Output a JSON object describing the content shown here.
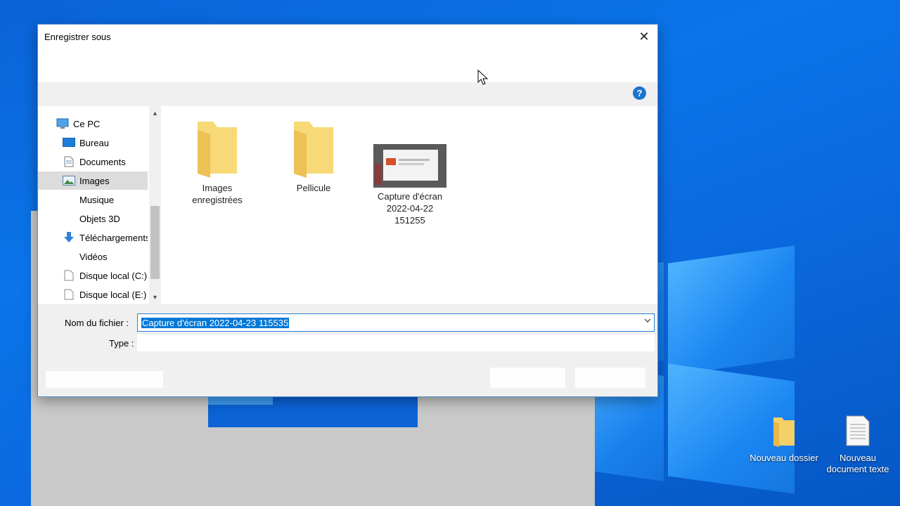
{
  "dialog": {
    "title": "Enregistrer sous",
    "help_symbol": "?",
    "close_symbol": "✕"
  },
  "nav": {
    "items": [
      {
        "label": "Ce PC",
        "icon": "pc-icon"
      },
      {
        "label": "Bureau",
        "icon": "desktop-icon"
      },
      {
        "label": "Documents",
        "icon": "documents-icon"
      },
      {
        "label": "Images",
        "icon": "pictures-icon",
        "selected": true
      },
      {
        "label": "Musique",
        "icon": "music-icon"
      },
      {
        "label": "Objets 3D",
        "icon": "objects3d-icon"
      },
      {
        "label": "Téléchargements",
        "icon": "download-icon"
      },
      {
        "label": "Vidéos",
        "icon": "videos-icon"
      },
      {
        "label": "Disque local (C:)",
        "icon": "drive-icon"
      },
      {
        "label": "Disque local (E:)",
        "icon": "drive-icon"
      }
    ]
  },
  "files": [
    {
      "line1": "Images",
      "line2": "enregistrées",
      "type": "folder"
    },
    {
      "line1": "Pellicule",
      "line2": "",
      "type": "folder"
    },
    {
      "line1": "Capture d'écran",
      "line2": "2022-04-22",
      "line3": "151255",
      "type": "image"
    }
  ],
  "form": {
    "filename_label": "Nom du fichier :",
    "filename_value": "Capture d'écran 2022-04-23 115535",
    "type_label": "Type :",
    "type_value": ""
  },
  "desktop": {
    "icons": [
      {
        "line1": "Nouveau dossier",
        "line2": ""
      },
      {
        "line1": "Nouveau",
        "line2": "document texte"
      }
    ]
  }
}
